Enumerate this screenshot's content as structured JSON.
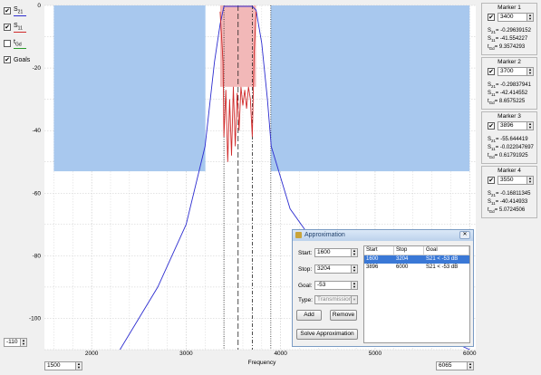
{
  "legend": {
    "items": [
      {
        "label": "S",
        "sub": "21",
        "checked": true,
        "color": "#2d2dd0"
      },
      {
        "label": "S",
        "sub": "11",
        "checked": true,
        "color": "#d02a2a"
      },
      {
        "label": "t",
        "sub": "Gd",
        "checked": false,
        "color": "#2b9a2b"
      },
      {
        "label": "Goals",
        "sub": "",
        "checked": true,
        "color": ""
      }
    ]
  },
  "chart_data": {
    "type": "line",
    "xlabel": "Frequency",
    "ylabel": "",
    "xlim": [
      1500,
      6065
    ],
    "ylim": [
      -110,
      0
    ],
    "x_ticks": [
      "2000",
      "3000",
      "4000",
      "5000",
      "6000"
    ],
    "y_ticks": [
      "0",
      "-20",
      "-40",
      "-60",
      "-80",
      "-100"
    ],
    "goal_regions": [
      {
        "start": 1600,
        "stop": 3204,
        "goal": -53
      },
      {
        "start": 3896,
        "stop": 6000,
        "goal": -53
      }
    ],
    "series": [
      {
        "name": "S21",
        "color": "#2d2dd0",
        "x": [
          2300,
          2700,
          3000,
          3200,
          3300,
          3360,
          3400,
          3500,
          3600,
          3700,
          3740,
          3800,
          3860,
          3900,
          4100,
          4500,
          5000,
          5500,
          6000
        ],
        "y": [
          -110,
          -90,
          -70,
          -45,
          -18,
          -6,
          -0.3,
          -0.3,
          -0.3,
          -0.3,
          -1.5,
          -12,
          -30,
          -45,
          -65,
          -82,
          -95,
          -103,
          -110
        ]
      },
      {
        "name": "S11",
        "color": "#d02a2a",
        "x": [
          3360,
          3390,
          3400,
          3420,
          3440,
          3460,
          3480,
          3500,
          3520,
          3540,
          3560,
          3580,
          3600,
          3620,
          3640,
          3660,
          3680,
          3700,
          3720,
          3740
        ],
        "y": [
          -2,
          -18,
          -42,
          -27,
          -50,
          -30,
          -48,
          -26,
          -45,
          -28,
          -40,
          -26,
          -32,
          -27,
          -33,
          -26,
          -30,
          -42,
          -15,
          -2
        ]
      }
    ],
    "marker_lines": [
      3400,
      3550,
      3700,
      3896
    ]
  },
  "axis_controls": {
    "ymin": "-110",
    "xmin": "1500",
    "xmax": "6065"
  },
  "markers": [
    {
      "title": "Marker 1",
      "value": "3400",
      "s21": "= -0.29639152",
      "s11": "= -41.554227",
      "tgd": "= 9.3574293"
    },
    {
      "title": "Marker 2",
      "value": "3700",
      "s21": "= -0.29837941",
      "s11": "= -42.414552",
      "tgd": "= 8.6575225"
    },
    {
      "title": "Marker 3",
      "value": "3896",
      "s21": "= -55.644419",
      "s11": "= -0.022047697",
      "tgd": "= 0.61791925"
    },
    {
      "title": "Marker 4",
      "value": "3550",
      "s21": "= -0.16811345",
      "s11": "= -40.414933",
      "tgd": "= 5.0724506"
    }
  ],
  "dialog": {
    "title": "Approximation",
    "start_label": "Start:",
    "start_value": "1600",
    "stop_label": "Stop:",
    "stop_value": "3204",
    "goal_label": "Goal:",
    "goal_value": "-53",
    "type_label": "Type:",
    "type_value": "Transmission",
    "add_label": "Add",
    "remove_label": "Remove",
    "solve_label": "Solve Approximation",
    "table": {
      "headers": [
        "Start",
        "Stop",
        "Goal"
      ],
      "rows": [
        [
          "1600",
          "3204",
          "S21 < -53 dB"
        ],
        [
          "3896",
          "6000",
          "S21 < -53 dB"
        ]
      ]
    }
  }
}
